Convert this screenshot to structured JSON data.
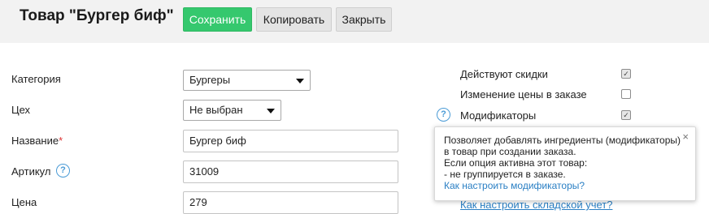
{
  "header": {
    "title": "Товар \"Бургер биф\"",
    "save_label": "Сохранить",
    "copy_label": "Копировать",
    "close_label": "Закрыть"
  },
  "form": {
    "category_label": "Категория",
    "category_value": "Бургеры",
    "workshop_label": "Цех",
    "workshop_value": "Не выбран",
    "name_label": "Название",
    "name_required_mark": "*",
    "name_value": "Бургер биф",
    "sku_label": "Артикул",
    "sku_value": "31009",
    "price_label": "Цена",
    "price_value": "279"
  },
  "options": {
    "discounts_label": "Действуют скидки",
    "discounts_checked": true,
    "price_change_label": "Изменение цены в заказе",
    "price_change_checked": false,
    "modifiers_label": "Модификаторы",
    "modifiers_checked": true,
    "cutoff_link": "Как настроить складской учет?"
  },
  "tooltip": {
    "text": "Позволяет добавлять ингредиенты (модификаторы)\nв товар при создании заказа.\nЕсли опция активна этот товар:\n- не группируется в заказе.",
    "link": "Как настроить модификаторы?",
    "close_glyph": "×"
  },
  "icons": {
    "help_glyph": "?",
    "check_glyph": "✓"
  },
  "colors": {
    "save_button": "#35c86e",
    "link": "#2a7fc4",
    "help_icon": "#4a9bd6",
    "header_bg": "#f2f2f2"
  }
}
